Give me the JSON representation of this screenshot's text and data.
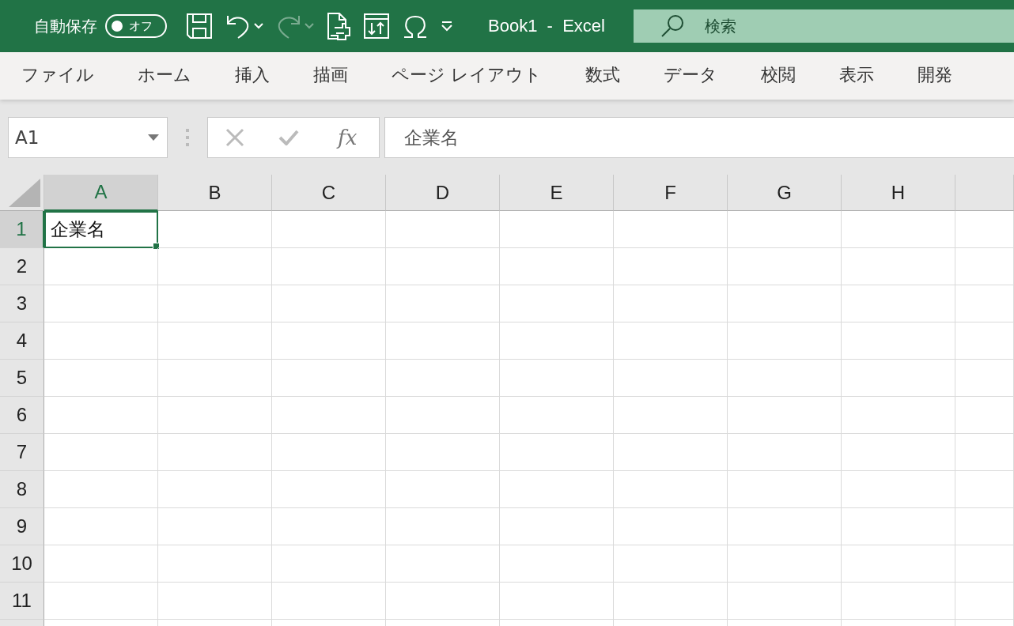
{
  "title_bar": {
    "autosave_label": "自動保存",
    "autosave_toggle": {
      "label": "オフ",
      "on": false
    },
    "quick_access": [
      {
        "kind": "save",
        "disabled": false
      },
      {
        "kind": "undo",
        "disabled": false
      },
      {
        "kind": "redo",
        "disabled": true
      },
      {
        "kind": "print-preview",
        "disabled": false
      },
      {
        "kind": "swap",
        "disabled": false
      },
      {
        "kind": "symbol",
        "disabled": false
      },
      {
        "kind": "customize",
        "disabled": false
      }
    ],
    "title": "Book1  -  Excel",
    "search": {
      "placeholder": "検索"
    }
  },
  "ribbon_tabs": [
    {
      "label": "ファイル",
      "selected": false
    },
    {
      "label": "ホーム",
      "selected": false
    },
    {
      "label": "挿入",
      "selected": false
    },
    {
      "label": "描画",
      "selected": false
    },
    {
      "label": "ページ レイアウト",
      "selected": false
    },
    {
      "label": "数式",
      "selected": false
    },
    {
      "label": "データ",
      "selected": false
    },
    {
      "label": "校閲",
      "selected": false
    },
    {
      "label": "表示",
      "selected": false
    },
    {
      "label": "開発",
      "selected": false
    }
  ],
  "formula_bar": {
    "name_box": "A1",
    "function_label": "fx",
    "value": "企業名"
  },
  "sheet": {
    "columns": [
      {
        "label": "A",
        "selected": true
      },
      {
        "label": "B",
        "selected": false
      },
      {
        "label": "C",
        "selected": false
      },
      {
        "label": "D",
        "selected": false
      },
      {
        "label": "E",
        "selected": false
      },
      {
        "label": "F",
        "selected": false
      },
      {
        "label": "G",
        "selected": false
      },
      {
        "label": "H",
        "selected": false
      }
    ],
    "rows": [
      {
        "label": "1",
        "selected": true,
        "cells": [
          {
            "text": "企業名",
            "active": true
          }
        ]
      },
      {
        "label": "2",
        "selected": false
      },
      {
        "label": "3",
        "selected": false
      },
      {
        "label": "4",
        "selected": false
      },
      {
        "label": "5",
        "selected": false
      },
      {
        "label": "6",
        "selected": false
      },
      {
        "label": "7",
        "selected": false
      },
      {
        "label": "8",
        "selected": false
      },
      {
        "label": "9",
        "selected": false
      },
      {
        "label": "10",
        "selected": false
      },
      {
        "label": "11",
        "selected": false
      }
    ]
  }
}
